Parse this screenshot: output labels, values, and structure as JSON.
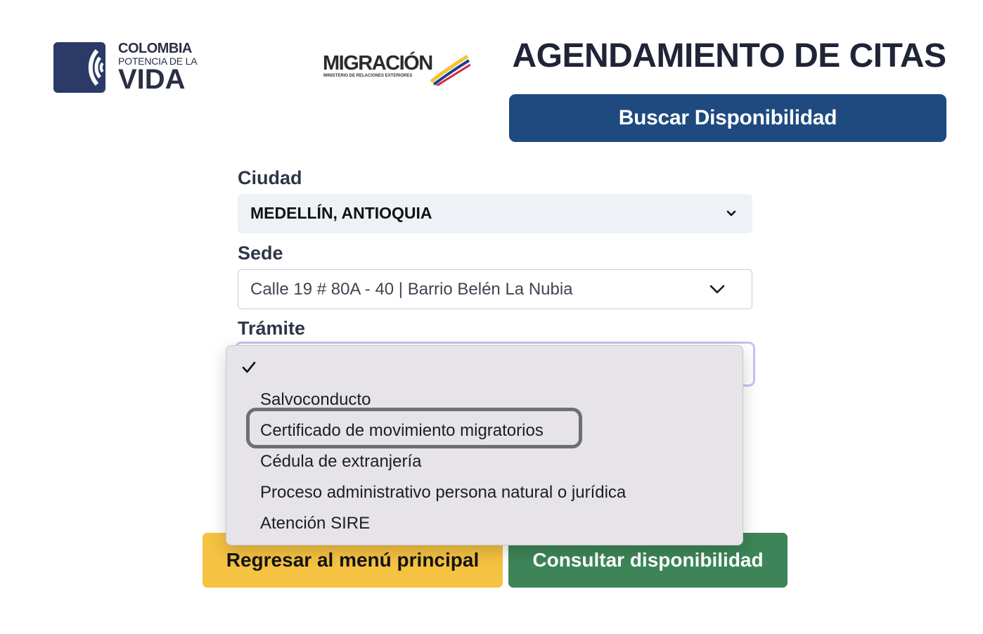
{
  "header": {
    "gov_logo": {
      "line1": "COLOMBIA",
      "line2": "POTENCIA DE LA",
      "line3": "VIDA"
    },
    "mig_logo": {
      "word": "MIGRACIÓN",
      "subtitle": "MINISTERIO DE RELACIONES EXTERIORES"
    },
    "title": "AGENDAMIENTO DE CITAS",
    "search_button": "Buscar Disponibilidad"
  },
  "form": {
    "ciudad": {
      "label": "Ciudad",
      "value": "MEDELLÍN, ANTIOQUIA"
    },
    "sede": {
      "label": "Sede",
      "value": "Calle 19 # 80A - 40 | Barrio Belén La Nubia"
    },
    "tramite": {
      "label": "Trámite",
      "selected_index": 0,
      "highlighted_index": 2,
      "options": [
        {
          "label": ""
        },
        {
          "label": "Salvoconducto"
        },
        {
          "label": "Certificado de movimiento migratorios"
        },
        {
          "label": "Cédula de extranjería"
        },
        {
          "label": "Proceso administrativo persona natural o jurídica"
        },
        {
          "label": "Atención SIRE"
        }
      ]
    }
  },
  "actions": {
    "back": "Regresar al menú principal",
    "check": "Consultar disponibilidad"
  },
  "colors": {
    "primary": "#1e4a80",
    "back_button": "#f5c242",
    "check_button": "#3d8558",
    "focus": "#c9c0f4"
  },
  "icons": {
    "ciudad_chevron": "chevron-down-icon",
    "sede_chevron": "chevron-down-icon",
    "selected_check": "checkmark-icon"
  }
}
